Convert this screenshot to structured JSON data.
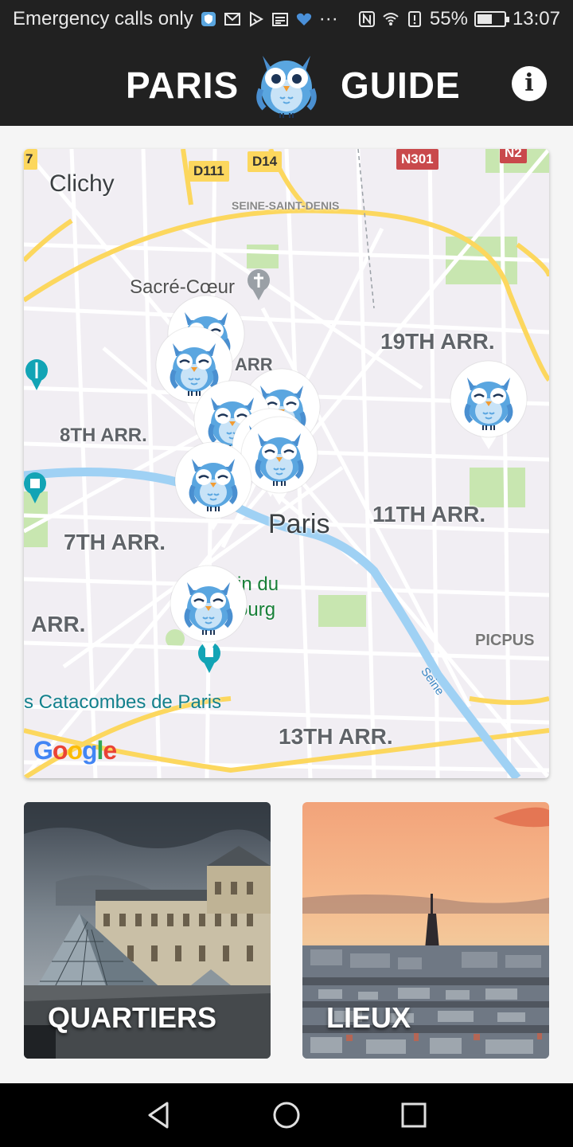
{
  "status_bar": {
    "carrier_text": "Emergency calls only",
    "overflow": "···",
    "battery_text": "55%",
    "battery_level": 0.55,
    "time": "13:07"
  },
  "app_bar": {
    "title_left": "PARIS",
    "title_right": "GUIDE",
    "logo_icon": "owl-icon",
    "info_icon": "info-icon",
    "info_glyph": "i"
  },
  "map": {
    "district_labels": [
      "19TH ARR.",
      "8TH ARR.",
      "11TH ARR.",
      "7TH ARR.",
      "ARR.",
      "13TH ARR.",
      "ARR"
    ],
    "city_labels": [
      "Clichy",
      "Paris"
    ],
    "poi_labels": {
      "sacre_coeur": "Sacré-Cœur",
      "seine_saint_denis": "SEINE-SAINT-DENIS",
      "picpus": "PICPUS",
      "seine": "Seine",
      "jardin_line1": "in du",
      "jardin_line2": "ourg",
      "catacombes": "s Catacombes de Paris"
    },
    "road_badges": [
      "D111",
      "D14",
      "N301",
      "N2",
      "7"
    ],
    "attribution": "Google",
    "marker_count": 9
  },
  "cards": [
    {
      "label": "QUARTIERS",
      "image": "louvre-pyramid-photo"
    },
    {
      "label": "LIEUX",
      "image": "eiffel-tower-sunset-photo"
    }
  ],
  "nav_bar": {
    "back_icon": "back-icon",
    "home_icon": "home-icon",
    "recents_icon": "recents-icon"
  },
  "colors": {
    "app_bar": "#212121",
    "owl_blue": "#5aa6e0",
    "map_bg": "#f1eef3",
    "road_major": "#fcd75e",
    "water": "#9fd1f4",
    "park": "#c8e6b0"
  }
}
